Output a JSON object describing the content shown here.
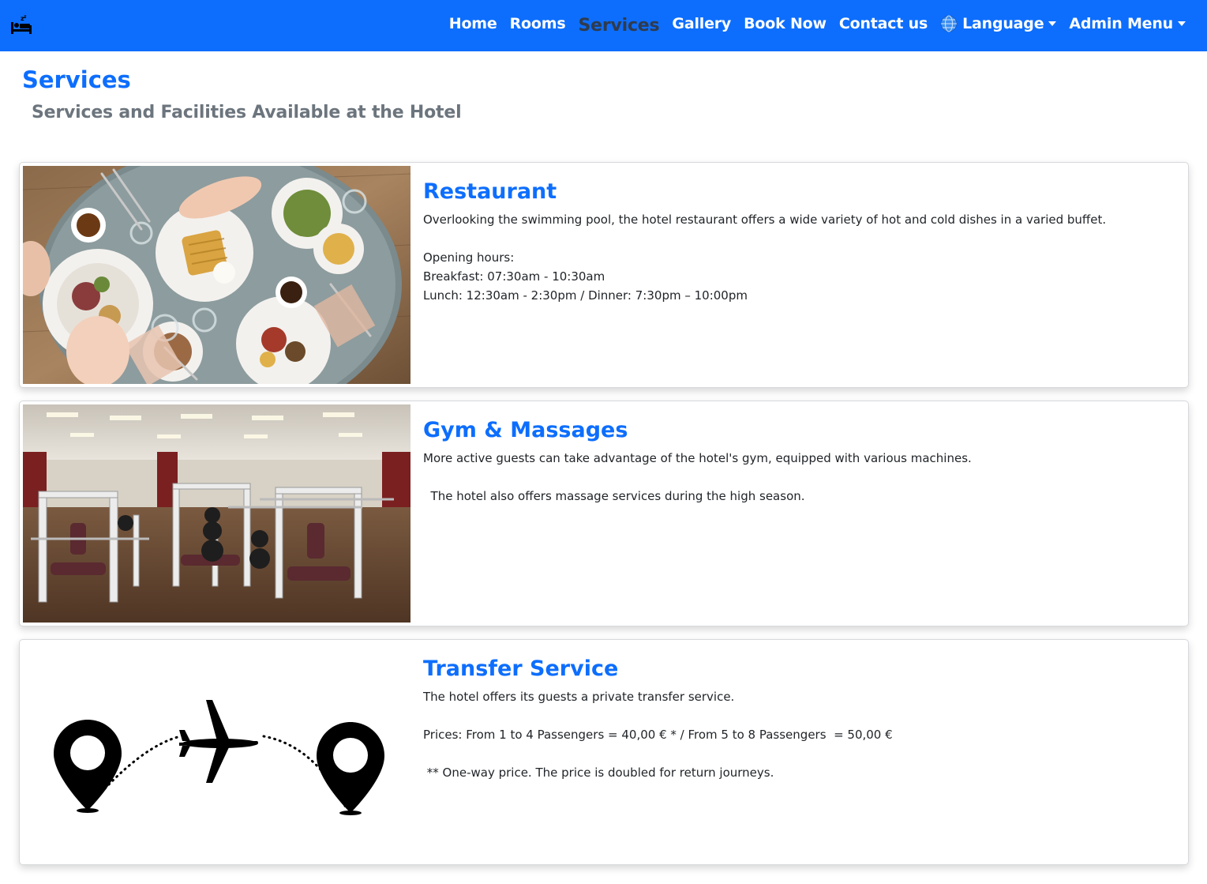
{
  "navbar": {
    "brand_icon": "bed-sleep-icon",
    "items": [
      {
        "label": "Home",
        "active": false
      },
      {
        "label": "Rooms",
        "active": false
      },
      {
        "label": "Services",
        "active": true
      },
      {
        "label": "Gallery",
        "active": false
      },
      {
        "label": "Book Now",
        "active": false
      },
      {
        "label": "Contact us",
        "active": false
      }
    ],
    "language_label": "Language",
    "language_icon": "globe-icon",
    "admin_label": "Admin Menu"
  },
  "page": {
    "title": "Services",
    "subtitle": "Services and Facilities Available at the Hotel"
  },
  "services": [
    {
      "title": "Restaurant",
      "image": "restaurant-photo",
      "lines": [
        "Overlooking the swimming pool, the hotel restaurant offers a wide variety of hot and cold dishes in a varied buffet.",
        "",
        "Opening hours:",
        "Breakfast: 07:30am - 10:30am",
        "Lunch: 12:30am - 2:30pm / Dinner: 7:30pm – 10:00pm"
      ]
    },
    {
      "title": "Gym & Massages",
      "image": "gym-photo",
      "lines": [
        "More active guests can take advantage of the hotel's gym, equipped with various machines.",
        "",
        "  The hotel also offers massage services during the high season."
      ]
    },
    {
      "title": "Transfer Service",
      "image": "transfer-illustration",
      "lines": [
        "The hotel offers its guests a private transfer service.",
        "",
        "Prices: From 1 to 4 Passengers = 40,00 € * / From 5 to 8 Passengers  = 50,00 €",
        "",
        " ** One-way price. The price is doubled for return journeys."
      ]
    }
  ],
  "colors": {
    "primary": "#0d6efd",
    "active_nav": "#2f3b4d",
    "subtitle": "#6c757d"
  }
}
